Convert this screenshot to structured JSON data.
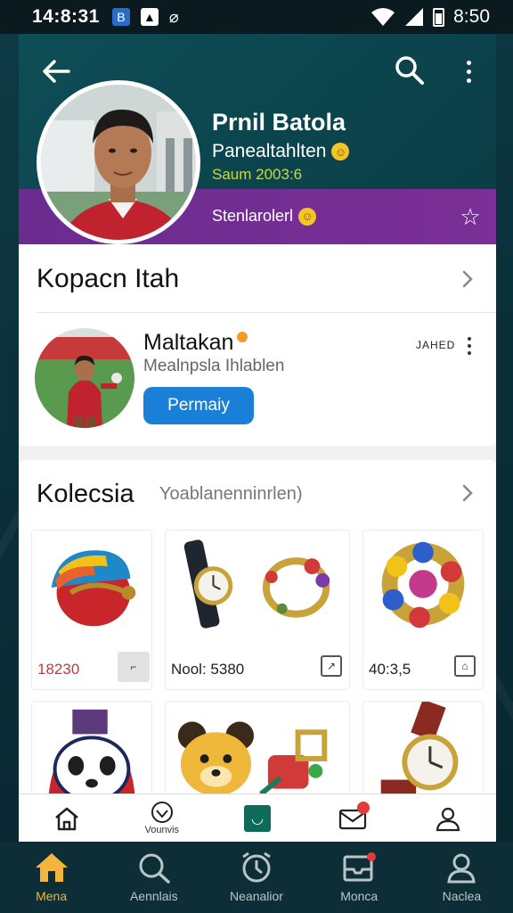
{
  "status_bar": {
    "time_left": "14:8:31",
    "time_right": "8:50"
  },
  "header": {
    "name": "Prnil Batola",
    "subtitle": "Panealtahlten",
    "meta": "Saum 2003:6",
    "status": "Stenlarolerl"
  },
  "section_following": {
    "title": "Kopacn Itah",
    "player": {
      "name": "Maltakan",
      "role": "Mealnpsla Ihlablen",
      "tag": "JAHED",
      "follow_label": "Permaiy"
    }
  },
  "collection": {
    "title": "Kolecsia",
    "subtitle": "Yoablanenninrlen)",
    "items": [
      {
        "price": "18230",
        "icon": "helmet-art"
      },
      {
        "price": "Nool: 5380",
        "icon": "watch-art"
      },
      {
        "price": "40:3,5",
        "icon": "bracelet-art"
      },
      {
        "price": "",
        "icon": "panda-art"
      },
      {
        "price": "",
        "icon": "bear-art"
      },
      {
        "price": "",
        "icon": "watch2-art"
      }
    ]
  },
  "inner_nav": {
    "items": [
      {
        "label": "",
        "icon": "home-icon"
      },
      {
        "label": "Vounvis",
        "icon": "heart-icon"
      },
      {
        "label": "",
        "icon": "app-icon"
      },
      {
        "label": "",
        "icon": "mail-icon",
        "badge": ""
      },
      {
        "label": "",
        "icon": "user-icon"
      }
    ]
  },
  "bottom_nav": {
    "items": [
      {
        "label": "Mena",
        "icon": "home-icon",
        "active": true
      },
      {
        "label": "Aennlais",
        "icon": "search-icon"
      },
      {
        "label": "Neanalior",
        "icon": "alarm-icon"
      },
      {
        "label": "Monca",
        "icon": "inbox-icon"
      },
      {
        "label": "Naclea",
        "icon": "user-icon"
      }
    ]
  },
  "colors": {
    "accent": "#1a7fd6",
    "header": "#0e4d56",
    "band": "#6a2c8f",
    "active_nav": "#f3b53b"
  }
}
